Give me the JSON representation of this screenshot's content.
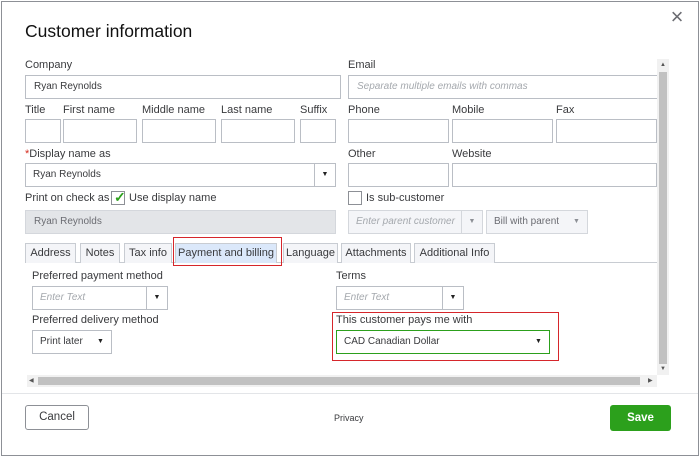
{
  "dialog": {
    "title": "Customer information",
    "close_icon": "close-icon"
  },
  "fields": {
    "company": {
      "label": "Company",
      "value": "Ryan Reynolds"
    },
    "email": {
      "label": "Email",
      "placeholder": "Separate multiple emails with commas"
    },
    "title": {
      "label": "Title",
      "value": ""
    },
    "first_name": {
      "label": "First name",
      "value": ""
    },
    "middle_name": {
      "label": "Middle name",
      "value": ""
    },
    "last_name": {
      "label": "Last name",
      "value": ""
    },
    "suffix": {
      "label": "Suffix",
      "value": ""
    },
    "phone": {
      "label": "Phone",
      "value": ""
    },
    "mobile": {
      "label": "Mobile",
      "value": ""
    },
    "fax": {
      "label": "Fax",
      "value": ""
    },
    "display_name": {
      "required_mark": "*",
      "label": "Display name as",
      "value": "Ryan Reynolds"
    },
    "other": {
      "label": "Other",
      "value": ""
    },
    "website": {
      "label": "Website",
      "value": ""
    },
    "print_on_check": {
      "label": "Print on check as",
      "checkbox_label": "Use display name",
      "checked": true,
      "value": "Ryan Reynolds"
    },
    "sub_customer": {
      "label": "Is sub-customer",
      "checked": false,
      "parent_placeholder": "Enter parent customer",
      "bill_with": "Bill with parent"
    }
  },
  "tabs": [
    {
      "label": "Address",
      "active": false
    },
    {
      "label": "Notes",
      "active": false
    },
    {
      "label": "Tax info",
      "active": false
    },
    {
      "label": "Payment and billing",
      "active": true
    },
    {
      "label": "Language",
      "active": false
    },
    {
      "label": "Attachments",
      "active": false
    },
    {
      "label": "Additional Info",
      "active": false
    }
  ],
  "payment": {
    "preferred_payment_method": {
      "label": "Preferred payment method",
      "placeholder": "Enter Text"
    },
    "terms": {
      "label": "Terms",
      "placeholder": "Enter Text"
    },
    "preferred_delivery_method": {
      "label": "Preferred delivery method",
      "value": "Print later"
    },
    "currency": {
      "label": "This customer pays me with",
      "value": "CAD Canadian Dollar"
    }
  },
  "footer": {
    "cancel_label": "Cancel",
    "privacy_label": "Privacy",
    "save_label": "Save"
  },
  "colors": {
    "save_green": "#2ca01c",
    "highlight_red": "#d6262b",
    "active_tab": "#dbe8fa"
  }
}
